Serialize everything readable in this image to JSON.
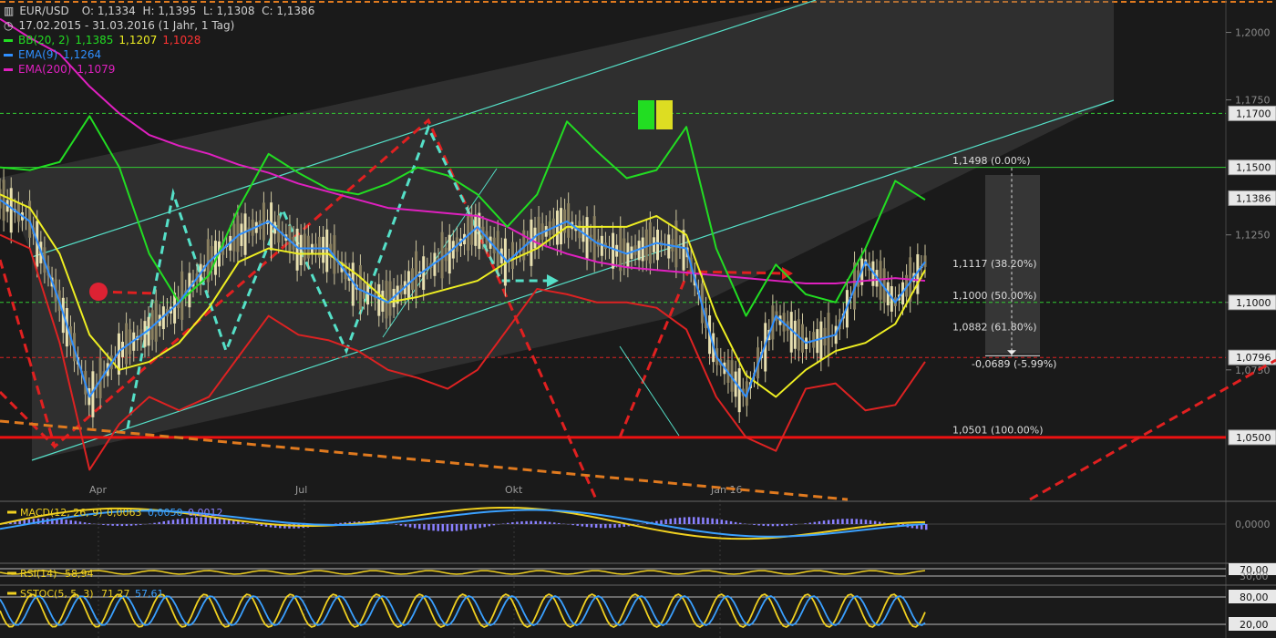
{
  "header": {
    "symbol": "EUR/USD",
    "ohlc_text": "O: 1,1334  H: 1,1395  L: 1,1308  C: 1,1386",
    "period": "17.02.2015 - 31.03.2016 (1 Jahr, 1 Tag)",
    "indicators": [
      {
        "label": "BB(20, 2)",
        "v1": "1,1385",
        "v2": "1,1207",
        "v3": "1,1028",
        "color": "#22dd22"
      },
      {
        "label": "EMA(9)",
        "v1": "1,1264",
        "color": "#2f8fff"
      },
      {
        "label": "EMA(200)",
        "v1": "1,1079",
        "color": "#e020c0"
      }
    ]
  },
  "chart_data": {
    "type": "line",
    "title": "EUR/USD",
    "x_ticks": [
      "Apr",
      "Jul",
      "Okt",
      "Jan 16"
    ],
    "y_ticks": [
      "1,2000",
      "1,1750",
      "1,1250",
      "1,1000",
      "1,0750"
    ],
    "ylim": [
      1.027,
      1.212
    ],
    "price_tags": [
      {
        "label": "1,1700",
        "value": 1.17,
        "style": "green-dash"
      },
      {
        "label": "1,1500",
        "value": 1.15,
        "style": "green-solid"
      },
      {
        "label": "1,1386",
        "value": 1.1386,
        "style": "current"
      },
      {
        "label": "1,1000",
        "value": 1.1,
        "style": "green-dash"
      },
      {
        "label": "1,0796",
        "value": 1.0796,
        "style": "red-dash"
      },
      {
        "label": "1,0500",
        "value": 1.05,
        "style": "red-solid"
      }
    ],
    "fibonacci": [
      {
        "label": "1,1498 (0.00%)",
        "value": 1.1498
      },
      {
        "label": "1,1117 (38.20%)",
        "value": 1.1117
      },
      {
        "label": "1,1000 (50.00%)",
        "value": 1.1
      },
      {
        "label": "1,0882 (61.80%)",
        "value": 1.0882
      },
      {
        "label": "1,0501 (100.00%)",
        "value": 1.0501
      }
    ],
    "measure_label": "-0,0689 (-5.99%)",
    "series": [
      {
        "name": "EMA(200)",
        "color": "#e020c0",
        "values": [
          1.205,
          1.198,
          1.192,
          1.18,
          1.17,
          1.162,
          1.158,
          1.155,
          1.151,
          1.148,
          1.144,
          1.141,
          1.138,
          1.135,
          1.134,
          1.133,
          1.132,
          1.128,
          1.122,
          1.118,
          1.115,
          1.113,
          1.112,
          1.111,
          1.11,
          1.109,
          1.108,
          1.107,
          1.107,
          1.108,
          1.109,
          1.108
        ]
      },
      {
        "name": "BB upper",
        "color": "#22dd22",
        "values": [
          1.15,
          1.149,
          1.152,
          1.169,
          1.15,
          1.118,
          1.1,
          1.11,
          1.135,
          1.155,
          1.148,
          1.142,
          1.14,
          1.144,
          1.15,
          1.147,
          1.14,
          1.128,
          1.14,
          1.167,
          1.156,
          1.146,
          1.149,
          1.165,
          1.12,
          1.095,
          1.114,
          1.103,
          1.1,
          1.12,
          1.145,
          1.138
        ]
      },
      {
        "name": "BB middle",
        "color": "#eeee22",
        "values": [
          1.14,
          1.135,
          1.118,
          1.088,
          1.075,
          1.078,
          1.085,
          1.098,
          1.115,
          1.12,
          1.118,
          1.118,
          1.11,
          1.1,
          1.102,
          1.105,
          1.108,
          1.115,
          1.12,
          1.128,
          1.128,
          1.128,
          1.132,
          1.125,
          1.095,
          1.073,
          1.065,
          1.075,
          1.082,
          1.085,
          1.092,
          1.112
        ]
      },
      {
        "name": "BB lower",
        "color": "#dd2222",
        "values": [
          1.125,
          1.12,
          1.085,
          1.038,
          1.055,
          1.065,
          1.06,
          1.065,
          1.08,
          1.095,
          1.088,
          1.086,
          1.082,
          1.075,
          1.072,
          1.068,
          1.075,
          1.09,
          1.105,
          1.103,
          1.1,
          1.1,
          1.098,
          1.09,
          1.065,
          1.05,
          1.045,
          1.068,
          1.07,
          1.06,
          1.062,
          1.078
        ]
      },
      {
        "name": "EMA(9)",
        "color": "#2f8fff",
        "values": [
          1.138,
          1.13,
          1.1,
          1.065,
          1.082,
          1.09,
          1.1,
          1.115,
          1.125,
          1.13,
          1.12,
          1.12,
          1.105,
          1.1,
          1.11,
          1.118,
          1.128,
          1.115,
          1.125,
          1.13,
          1.122,
          1.118,
          1.122,
          1.12,
          1.08,
          1.065,
          1.095,
          1.085,
          1.088,
          1.115,
          1.1,
          1.115
        ]
      }
    ],
    "subpanels": [
      {
        "name": "MACD",
        "label": "MACD(12, 26, 9)",
        "values": [
          "0,0063",
          "0,0050",
          "0,0012"
        ],
        "tick": "0,0000"
      },
      {
        "name": "RSI",
        "label": "RSI(14)",
        "values": [
          "58,94"
        ],
        "ticks": [
          "70,00",
          "30,00"
        ]
      },
      {
        "name": "SSTOC",
        "label": "SSTOC(5, 5, 3)",
        "values": [
          "71,27",
          "57,61"
        ],
        "ticks": [
          "80,00",
          "20,00"
        ]
      }
    ]
  }
}
